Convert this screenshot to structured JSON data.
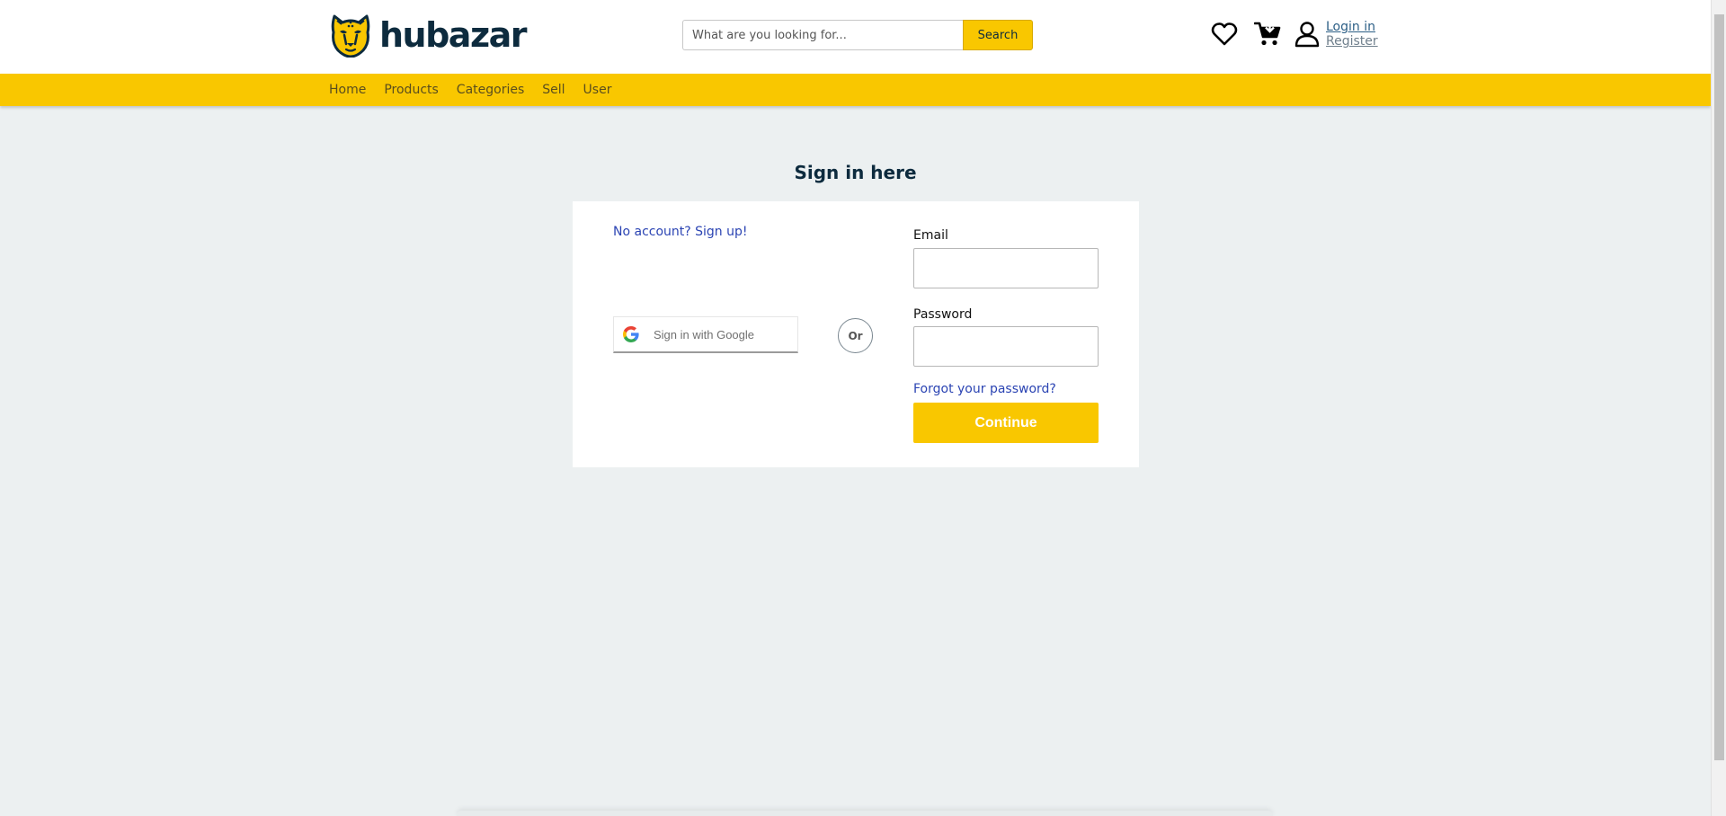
{
  "brand": {
    "name": "hubazar"
  },
  "search": {
    "placeholder": "What are you looking for...",
    "button_label": "Search"
  },
  "header": {
    "icons": [
      "heart-icon",
      "cart-icon",
      "user-icon"
    ],
    "login_label": "Login in",
    "register_label": "Register"
  },
  "nav": {
    "items": [
      "Home",
      "Products",
      "Categories",
      "Sell",
      "User"
    ]
  },
  "signin": {
    "title": "Sign in here",
    "signup_link": "No account? Sign up!",
    "google_label": "Sign in with Google",
    "or_label": "Or",
    "email_label": "Email",
    "password_label": "Password",
    "forgot_link": "Forgot your password?",
    "continue_label": "Continue"
  },
  "colors": {
    "accent": "#f9c700",
    "brand_dark": "#0d2b3e",
    "link": "#2b44b3",
    "page_bg": "#ecf0f1"
  }
}
